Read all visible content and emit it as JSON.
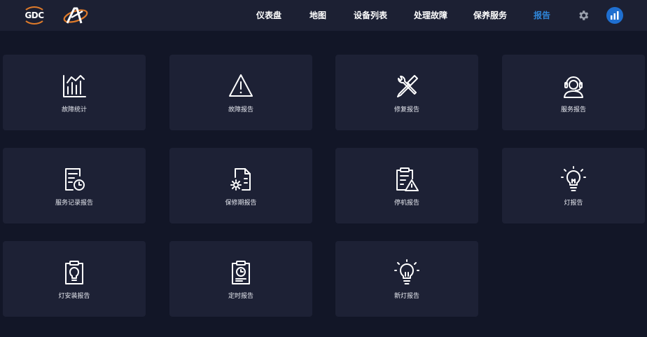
{
  "nav": {
    "items": [
      {
        "label": "仪表盘"
      },
      {
        "label": "地图"
      },
      {
        "label": "设备列表"
      },
      {
        "label": "处理故障"
      },
      {
        "label": "保养服务"
      },
      {
        "label": "报告"
      }
    ],
    "active": "报告"
  },
  "brand": {
    "logo_text": "GDC",
    "accent": "#e07b2a",
    "active_color": "#2f86d9"
  },
  "tiles": [
    {
      "label": "故障统计",
      "icon": "bar-chart-icon"
    },
    {
      "label": "故障报告",
      "icon": "warning-triangle-icon"
    },
    {
      "label": "修复报告",
      "icon": "wrench-screwdriver-icon"
    },
    {
      "label": "服务报告",
      "icon": "support-agent-icon"
    },
    {
      "label": "服务记录报告",
      "icon": "document-clock-icon"
    },
    {
      "label": "保修期报告",
      "icon": "document-gear-icon"
    },
    {
      "label": "停机报告",
      "icon": "clipboard-warning-icon"
    },
    {
      "label": "灯报告",
      "icon": "light-bulb-icon"
    },
    {
      "label": "灯安装报告",
      "icon": "clipboard-bulb-icon"
    },
    {
      "label": "定时报告",
      "icon": "clipboard-clock-icon"
    },
    {
      "label": "新灯报告",
      "icon": "new-bulb-icon"
    }
  ]
}
